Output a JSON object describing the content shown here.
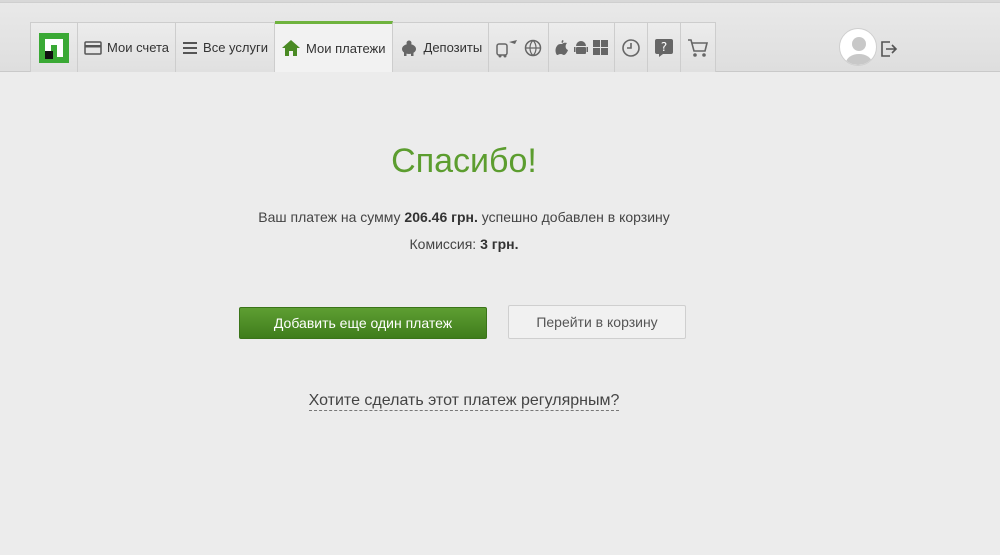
{
  "nav": {
    "logo": "privatbank-logo",
    "tabs": [
      {
        "label": "Мои счета",
        "icon": "card-icon"
      },
      {
        "label": "Все услуги",
        "icon": "list-icon"
      },
      {
        "label": "Мои платежи",
        "icon": "home-icon",
        "active": true
      },
      {
        "label": "Депозиты",
        "icon": "piggy-bank-icon"
      }
    ],
    "icon_tabs": [
      [
        "transport-icon",
        "globe-icon"
      ],
      [
        "apple-icon",
        "android-icon",
        "windows-icon"
      ],
      [
        "history-icon"
      ],
      [
        "help-icon"
      ],
      [
        "cart-icon"
      ]
    ]
  },
  "user": {
    "avatar": "avatar",
    "logout_icon": "logout-icon"
  },
  "content": {
    "title": "Спасибо!",
    "line1_prefix": "Ваш платеж на сумму ",
    "amount": "206.46 грн.",
    "line1_suffix": " успешно добавлен в корзину",
    "fee_label": "Комиссия: ",
    "fee": "3 грн.",
    "add_payment_button": "Добавить еще один платеж",
    "cart_button": "Перейти в корзину",
    "regular_link": "Хотите сделать этот платеж регулярным?"
  },
  "colors": {
    "accent": "#5c9d2f",
    "button": "#4a8a24"
  }
}
